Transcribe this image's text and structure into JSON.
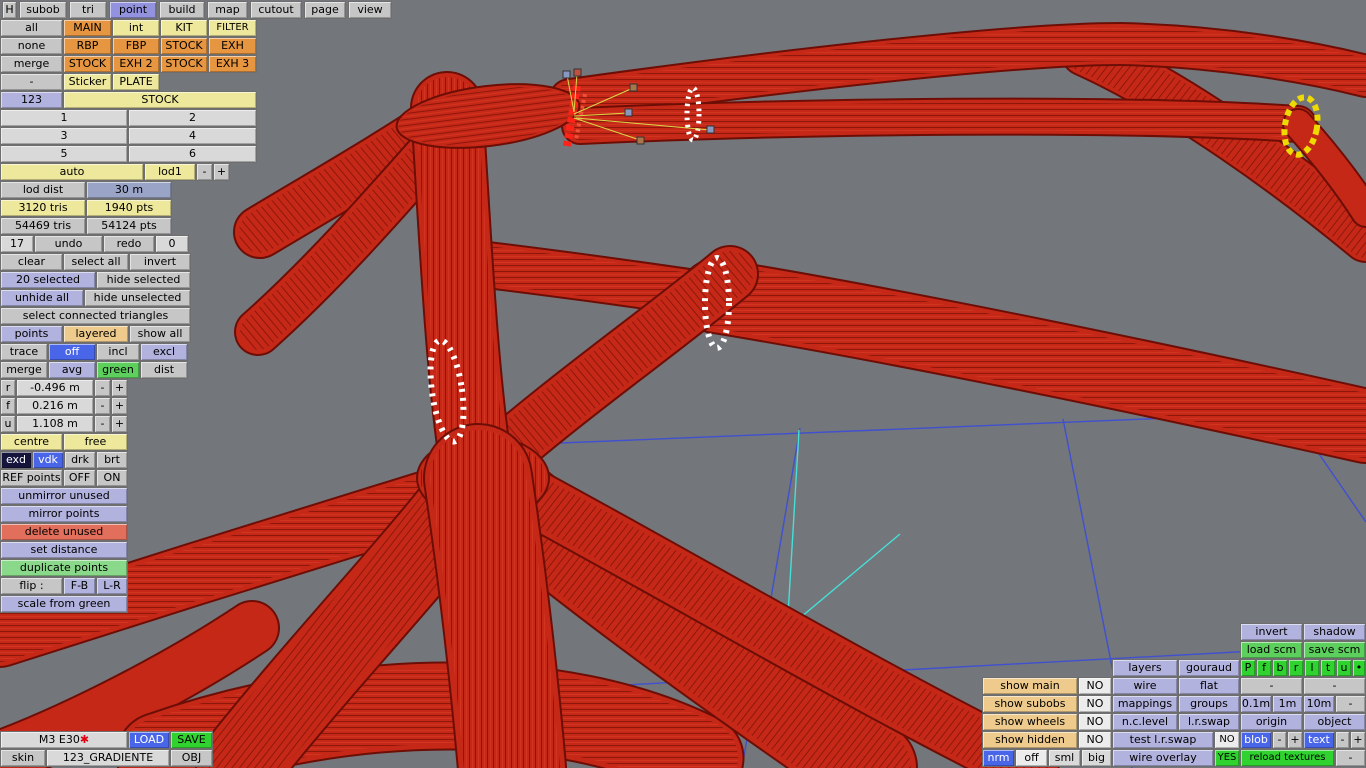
{
  "colors": {
    "viewport_bg": "#73767b",
    "grid_blue": "#4050d0",
    "axis_cyan": "#45e0d8",
    "tube_red": "#c62817",
    "selection_white": "#ffffff",
    "highlight_yellow": "#eeda00",
    "accent_blue": "#4a66e8",
    "accent_green": "#2fd22f",
    "accent_lavender": "#b2b2df",
    "accent_orange": "#e69540"
  },
  "menu": {
    "h": "H",
    "items": [
      "subob",
      "tri",
      "point",
      "build",
      "map",
      "cutout",
      "page",
      "view"
    ],
    "active": "point"
  },
  "lp": {
    "all": "all",
    "none": "none",
    "merge": "merge",
    "dash": "-",
    "main": "MAIN",
    "int": "int",
    "kit": "KIT",
    "filter": "FILTER",
    "rbp": "RBP",
    "fbp": "FBP",
    "stock": "STOCK",
    "exh": "EXH",
    "stock2": "STOCK",
    "exh2": "EXH 2",
    "stock3": "STOCK",
    "exh3": "EXH 3",
    "sticker": "Sticker",
    "plate": "PLATE",
    "num": "123",
    "stock_bar": "STOCK",
    "pages": [
      "1",
      "2",
      "3",
      "4",
      "5",
      "6"
    ],
    "auto": "auto",
    "lod1": "lod1",
    "lod_dist": "lod dist",
    "lod_dist_val": "30 m",
    "sel_tris": "3120 tris",
    "sel_pts": "1940 pts",
    "tot_tris": "54469 tris",
    "tot_pts": "54124 pts",
    "undo_n": "17",
    "undo": "undo",
    "redo": "redo",
    "redo_n": "0",
    "clear": "clear",
    "select_all": "select all",
    "invert": "invert",
    "n_selected": "20 selected",
    "hide_selected": "hide selected",
    "unhide_all": "unhide all",
    "hide_unselected": "hide unselected",
    "select_connected": "select connected triangles",
    "points": "points",
    "layered": "layered",
    "show_all": "show all",
    "trace": "trace",
    "off": "off",
    "incl": "incl",
    "excl": "excl",
    "merge2": "merge",
    "avg": "avg",
    "green": "green",
    "dist": "dist",
    "r": "r",
    "r_val": "-0.496 m",
    "f": "f",
    "f_val": "0.216 m",
    "u": "u",
    "u_val": "1.108 m",
    "minus": "-",
    "plus": "+",
    "centre": "centre",
    "free": "free",
    "exd": "exd",
    "vdk": "vdk",
    "drk": "drk",
    "brt": "brt",
    "ref": "REF points",
    "ref_off": "OFF",
    "ref_on": "ON",
    "unmirror": "unmirror unused",
    "mirror": "mirror points",
    "del_unused": "delete unused",
    "set_dist": "set distance",
    "dup_points": "duplicate points",
    "flip": "flip :",
    "fb": "F-B",
    "lr": "L-R",
    "scale_green": "scale from green"
  },
  "file": {
    "model": "M3 E30",
    "modified_mark": "✱",
    "load": "LOAD",
    "save": "SAVE",
    "skin_label": "skin",
    "skin_name": "123_GRADIENTE",
    "obj": "OBJ"
  },
  "rp": {
    "invert": "invert",
    "shadow": "shadow",
    "load_scm": "load scm",
    "save_scm": "save scm",
    "layers": "layers",
    "gouraud": "gouraud",
    "mini": [
      "P",
      "f",
      "b",
      "r",
      "l",
      "t",
      "u",
      "•"
    ],
    "show_main": "show main",
    "show_subobs": "show subobs",
    "show_wheels": "show wheels",
    "show_hidden": "show hidden",
    "no": "NO",
    "yes": "YES",
    "wire": "wire",
    "flat": "flat",
    "mappings": "mappings",
    "groups": "groups",
    "nc_level": "n.c.level",
    "lr_swap": "l.r.swap",
    "test_lr_swap": "test l.r.swap",
    "m01": "0.1m",
    "m1": "1m",
    "m10": "10m",
    "origin": "origin",
    "object": "object",
    "blob": "blob",
    "text": "text",
    "minus": "-",
    "plus": "+",
    "nrm": "nrm",
    "off": "off",
    "sml": "sml",
    "big": "big",
    "wire_overlay": "wire overlay",
    "reload_textures": "reload textures"
  }
}
